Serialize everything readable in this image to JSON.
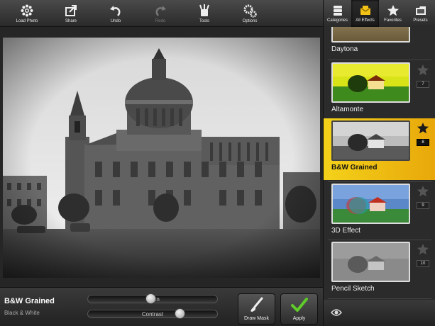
{
  "toolbar": {
    "items": [
      {
        "label": "Load Photo",
        "icon": "gear-flower-icon"
      },
      {
        "label": "Share",
        "icon": "share-icon"
      },
      {
        "label": "Undo",
        "icon": "undo-icon"
      },
      {
        "label": "Redo",
        "icon": "redo-icon"
      },
      {
        "label": "Tools",
        "icon": "tools-icon"
      },
      {
        "label": "Options",
        "icon": "options-icon"
      }
    ]
  },
  "tabs": [
    {
      "label": "Categories",
      "icon": "categories-icon"
    },
    {
      "label": "All Effects",
      "icon": "all-effects-icon"
    },
    {
      "label": "Favorites",
      "icon": "star-icon"
    },
    {
      "label": "Presets",
      "icon": "presets-icon"
    }
  ],
  "effects": [
    {
      "name": "Daytona"
    },
    {
      "name": "Altamonte",
      "number": "7"
    },
    {
      "name": "B&W Grained",
      "number": "8"
    },
    {
      "name": "3D Effect",
      "number": "9"
    },
    {
      "name": "Pencil Sketch",
      "number": "10"
    }
  ],
  "bottom": {
    "effect_title": "B&W Grained",
    "effect_category": "Black & White",
    "slider1_label": "Grain",
    "slider1_value": 0.48,
    "slider2_label": "Contrast",
    "slider2_value": 0.72,
    "draw_mask_label": "Draw Mask",
    "apply_label": "Apply"
  },
  "colors": {
    "accent": "#f2c316",
    "apply_check": "#5ecb2a"
  }
}
